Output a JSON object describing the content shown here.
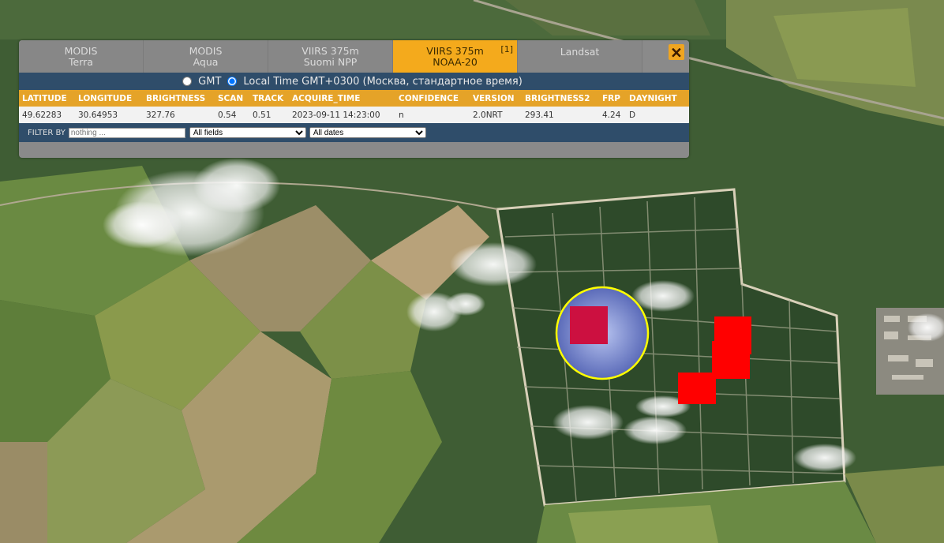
{
  "tabs": [
    {
      "line1": "MODIS",
      "line2": "Terra",
      "active": false
    },
    {
      "line1": "MODIS",
      "line2": "Aqua",
      "active": false
    },
    {
      "line1": "VIIRS 375m",
      "line2": "Suomi NPP",
      "active": false
    },
    {
      "line1": "VIIRS 375m",
      "line2": "NOAA-20",
      "badge": "[1]",
      "active": true
    },
    {
      "line1": "Landsat",
      "line2": "",
      "active": false
    }
  ],
  "close_glyph": "🗙",
  "timezone": {
    "gmt_label": "GMT",
    "local_label": "Local Time GMT+0300 (Москва, стандартное время)",
    "selected": "local"
  },
  "table": {
    "headers": [
      "LATITUDE",
      "LONGITUDE",
      "BRIGHTNESS",
      "SCAN",
      "TRACK",
      "ACQUIRE_TIME",
      "CONFIDENCE",
      "VERSION",
      "BRIGHTNESS2",
      "FRP",
      "DAYNIGHT"
    ],
    "rows": [
      [
        "49.62283",
        "30.64953",
        "327.76",
        "0.54",
        "0.51",
        "2023-09-11 14:23:00",
        "n",
        "2.0NRT",
        "293.41",
        "4.24",
        "D"
      ]
    ]
  },
  "filter": {
    "label": "FILTER BY",
    "placeholder": "nothing ...",
    "field_selected": "All fields",
    "date_selected": "All dates"
  },
  "colors": {
    "active_tab": "#f4aa1c",
    "header_bar": "#e5a328",
    "dark_bar": "#2f4d6a",
    "fire_pixel": "#ff0000",
    "selected_pixel": "#cc1040",
    "highlight_ring": "#ffff00"
  }
}
